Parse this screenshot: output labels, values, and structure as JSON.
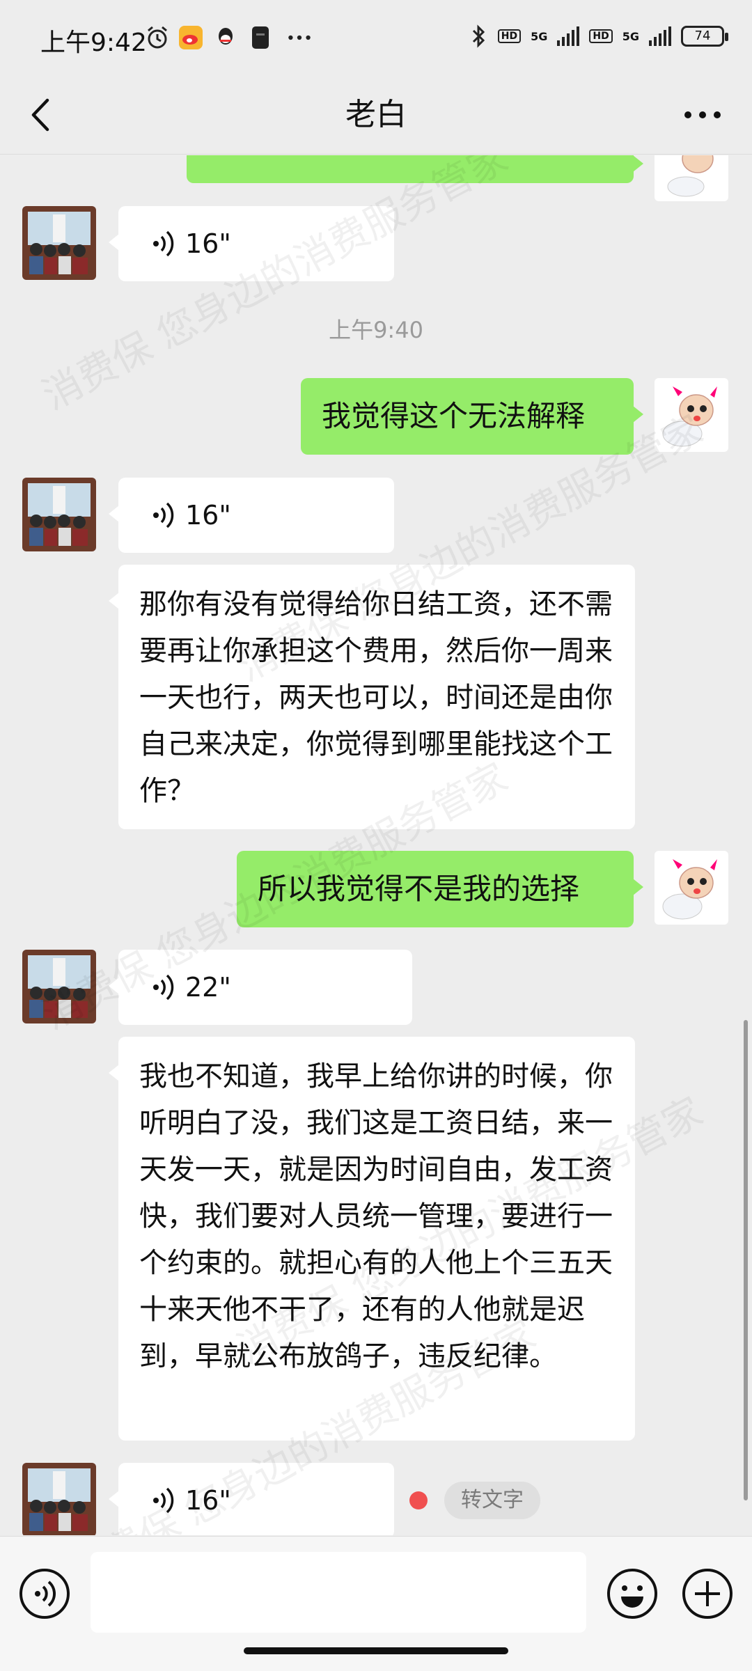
{
  "status_bar": {
    "time": "上午9:42",
    "network_1": "5G",
    "network_2": "5G",
    "hd_1": "HD",
    "hd_2": "HD",
    "battery": "74",
    "icons": [
      "alarm-icon",
      "weibo-icon",
      "qq-icon",
      "app-icon",
      "more-dots-icon",
      "bluetooth-icon"
    ]
  },
  "header": {
    "title": "老白",
    "back_icon": "chevron-left-icon",
    "more_icon": "more-dots-icon"
  },
  "messages": {
    "voice_1": "16\"",
    "timestamp": "上午9:40",
    "out_1": "我觉得这个无法解释",
    "voice_2": "16\"",
    "in_text_1": "那你有没有觉得给你日结工资，还不需要再让你承担这个费用，然后你一周来一天也行，两天也可以，时间还是由你自己来决定，你觉得到哪里能找这个工作？",
    "out_2": "所以我觉得不是我的选择",
    "voice_3": "22\"",
    "in_text_2": "我也不知道，我早上给你讲的时候，你听明白了没，我们这是工资日结，来一天发一天，就是因为时间自由，发工资快，我们要对人员统一管理，要进行一个约束的。就担心有的人他上个三五天十来天他不干了，还有的人他就是迟到，早就公布放鸽子，违反纪律。",
    "voice_4": "16\"",
    "to_text_label": "转文字"
  },
  "watermark": "消费保 您身边的消费服务管家",
  "input_bar": {
    "placeholder": "",
    "voice_icon": "voice-mode-icon",
    "emoji_icon": "emoji-icon",
    "plus_icon": "plus-icon"
  },
  "colors": {
    "background": "#ededed",
    "outgoing_bubble": "#95ec69",
    "incoming_bubble": "#ffffff",
    "unread_dot": "#f05050"
  }
}
